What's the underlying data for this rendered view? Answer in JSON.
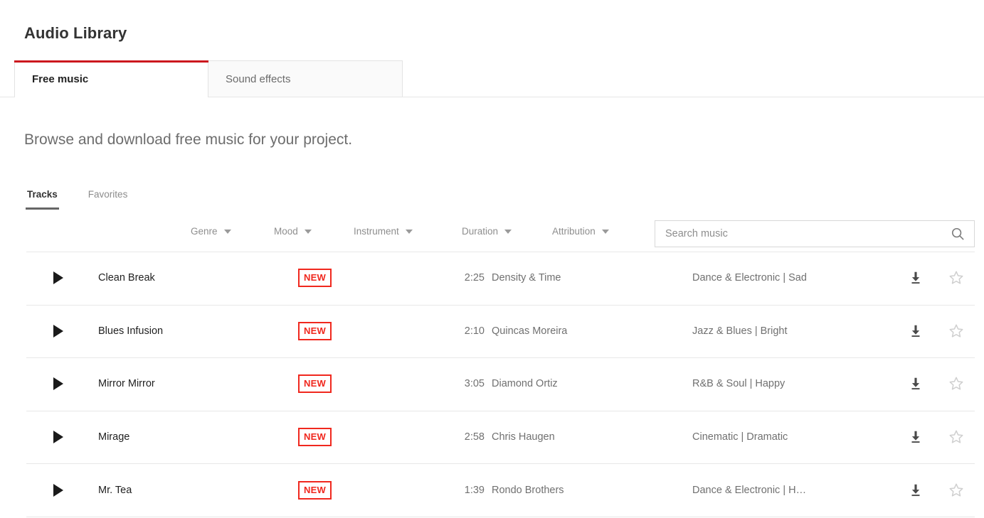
{
  "header": {
    "title": "Audio Library",
    "tabs": [
      {
        "label": "Free music",
        "active": true
      },
      {
        "label": "Sound effects",
        "active": false
      }
    ],
    "accent_color": "#cc181e"
  },
  "subtitle": "Browse and download free music for your project.",
  "subtabs": [
    {
      "label": "Tracks",
      "active": true
    },
    {
      "label": "Favorites",
      "active": false
    }
  ],
  "filters": [
    {
      "label": "Genre"
    },
    {
      "label": "Mood"
    },
    {
      "label": "Instrument"
    },
    {
      "label": "Duration"
    },
    {
      "label": "Attribution"
    }
  ],
  "search": {
    "placeholder": "Search music",
    "value": "",
    "icon": "search-icon"
  },
  "badge_color": "#f0281e",
  "tracks": [
    {
      "play_icon": "play-icon",
      "title": "Clean Break",
      "badge": "NEW",
      "duration": "2:25",
      "artist": "Density & Time",
      "attribution": "Dance & Electronic | Sad",
      "download_icon": "download-icon",
      "favorite_icon": "star-outline-icon"
    },
    {
      "play_icon": "play-icon",
      "title": "Blues Infusion",
      "badge": "NEW",
      "duration": "2:10",
      "artist": "Quincas Moreira",
      "attribution": "Jazz & Blues | Bright",
      "download_icon": "download-icon",
      "favorite_icon": "star-outline-icon"
    },
    {
      "play_icon": "play-icon",
      "title": "Mirror Mirror",
      "badge": "NEW",
      "duration": "3:05",
      "artist": "Diamond Ortiz",
      "attribution": "R&B & Soul | Happy",
      "download_icon": "download-icon",
      "favorite_icon": "star-outline-icon"
    },
    {
      "play_icon": "play-icon",
      "title": "Mirage",
      "badge": "NEW",
      "duration": "2:58",
      "artist": "Chris Haugen",
      "attribution": "Cinematic | Dramatic",
      "download_icon": "download-icon",
      "favorite_icon": "star-outline-icon"
    },
    {
      "play_icon": "play-icon",
      "title": "Mr. Tea",
      "badge": "NEW",
      "duration": "1:39",
      "artist": "Rondo Brothers",
      "attribution": "Dance & Electronic | H…",
      "download_icon": "download-icon",
      "favorite_icon": "star-outline-icon"
    }
  ]
}
